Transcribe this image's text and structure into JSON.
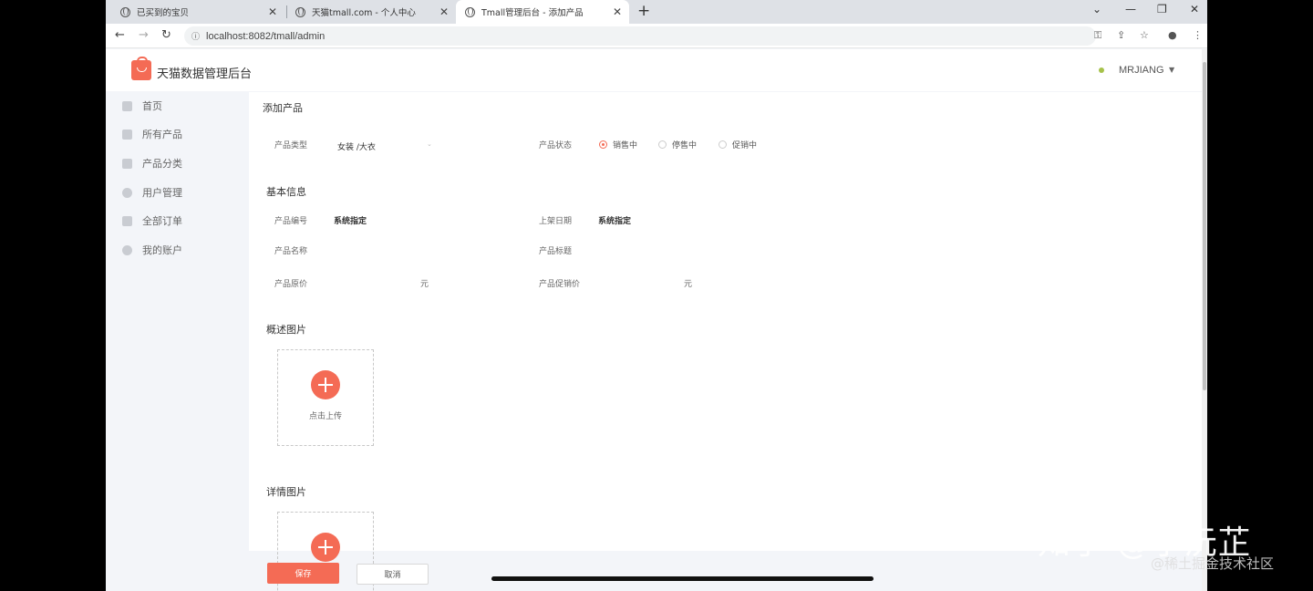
{
  "browser": {
    "tabs": [
      {
        "title": "已买到的宝贝"
      },
      {
        "title": "天猫tmall.com - 个人中心"
      },
      {
        "title": "Tmall管理后台 - 添加产品"
      }
    ],
    "new_tab": "+",
    "url": "localhost:8082/tmall/admin",
    "window_controls": [
      "⌄",
      "—",
      "❐",
      "✕"
    ]
  },
  "header": {
    "app_title": "天猫数据管理后台",
    "user_name": "MRJIANG"
  },
  "sidebar": {
    "items": [
      {
        "label": "首页",
        "icon": "home-icon"
      },
      {
        "label": "所有产品",
        "icon": "product-icon"
      },
      {
        "label": "产品分类",
        "icon": "category-icon"
      },
      {
        "label": "用户管理",
        "icon": "user-icon"
      },
      {
        "label": "全部订单",
        "icon": "order-icon"
      },
      {
        "label": "我的账户",
        "icon": "gear-icon"
      }
    ]
  },
  "form": {
    "page_title": "添加产品",
    "product_type_label": "产品类型",
    "product_type_value": "女装 /大衣",
    "product_status_label": "产品状态",
    "status_options": [
      {
        "label": "销售中",
        "selected": true
      },
      {
        "label": "停售中",
        "selected": false
      },
      {
        "label": "促销中",
        "selected": false
      }
    ],
    "basic_info_title": "基本信息",
    "product_id_label": "产品编号",
    "product_id_value": "系统指定",
    "shelf_date_label": "上架日期",
    "shelf_date_value": "系统指定",
    "product_name_label": "产品名称",
    "product_title_label": "产品标题",
    "original_price_label": "产品原价",
    "original_price_unit": "元",
    "promo_price_label": "产品促销价",
    "promo_price_unit": "元",
    "overview_images_title": "概述图片",
    "upload_label": "点击上传",
    "detail_images_title": "详情图片"
  },
  "footer": {
    "save_label": "保存",
    "cancel_label": "取消"
  },
  "overlay": {
    "watermark_main": "知乎 @小沅芷",
    "watermark_sub": "@稀土掘金技术社区"
  },
  "colors": {
    "accent": "#f46b55",
    "sidebar_bg": "#f3f5f9",
    "panel_bg": "#ffffff"
  }
}
